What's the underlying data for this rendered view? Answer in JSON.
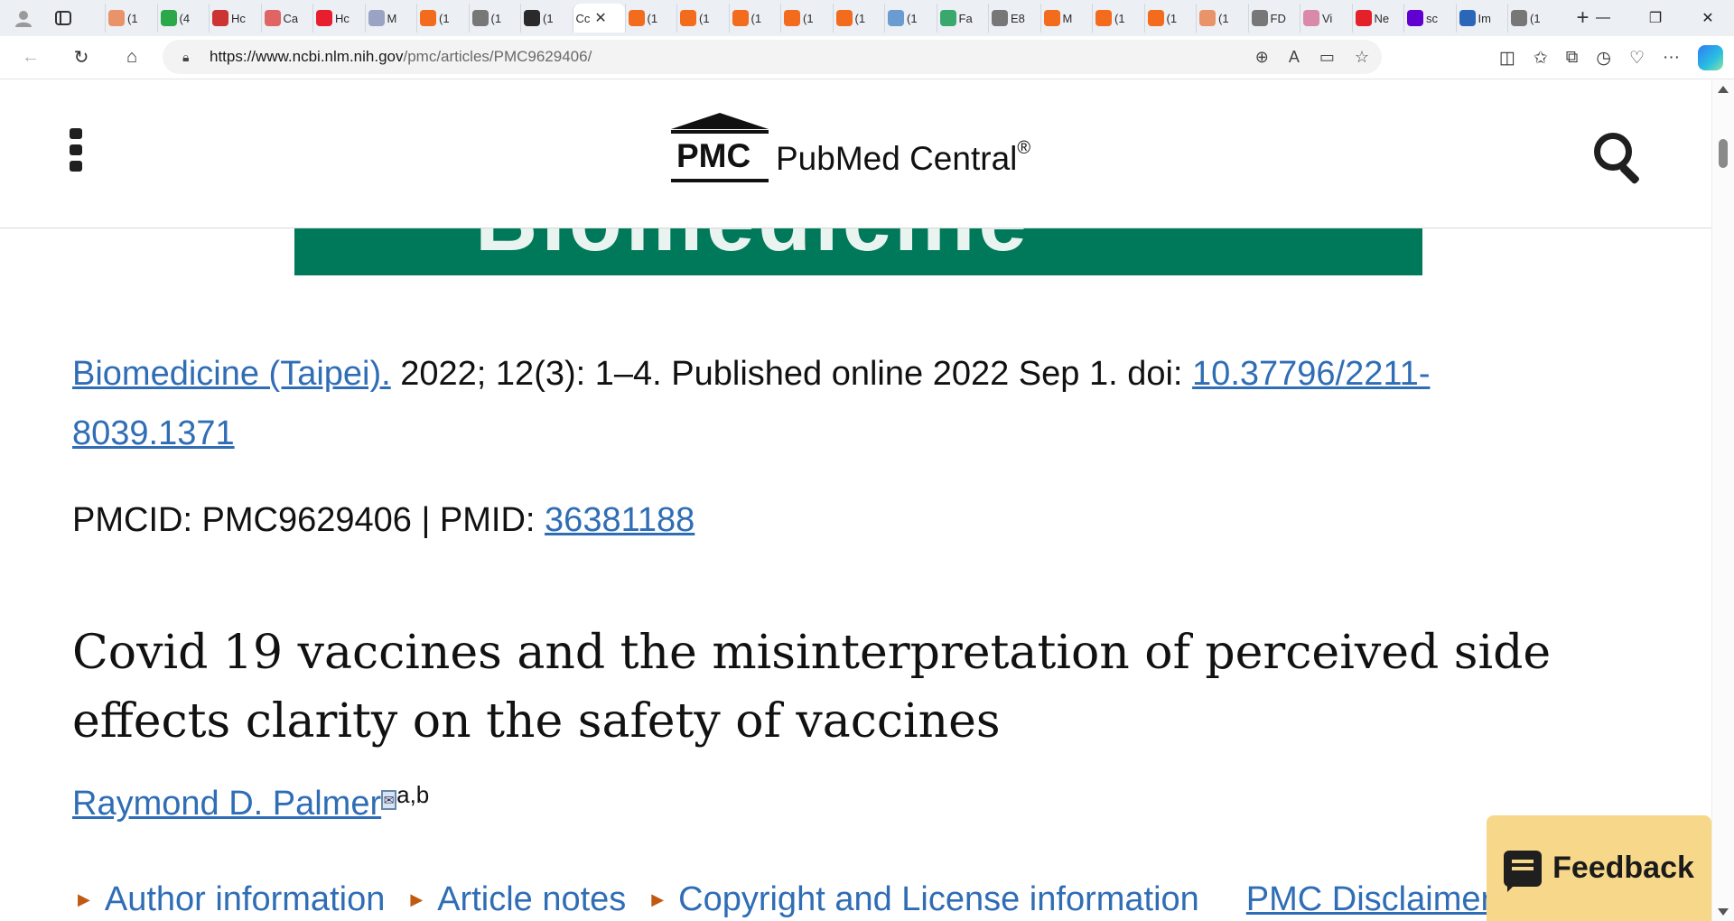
{
  "browser": {
    "tabs": [
      {
        "title": "(1",
        "icon": "bookmark-icon",
        "color": "#e8936a"
      },
      {
        "title": "(4",
        "icon": "g-icon",
        "color": "#2aa84a"
      },
      {
        "title": "Hc",
        "icon": "bi-icon",
        "color": "#cc3333"
      },
      {
        "title": "Ca",
        "icon": "video-icon",
        "color": "#e06464"
      },
      {
        "title": "Hc",
        "icon": "drop-icon",
        "color": "#e81d2d"
      },
      {
        "title": "M",
        "icon": "ai-icon",
        "color": "#9aa3c4"
      },
      {
        "title": "(1",
        "icon": "bookmark-icon",
        "color": "#f36b1c"
      },
      {
        "title": "(1",
        "icon": "page-icon",
        "color": "#777777"
      },
      {
        "title": "(1",
        "icon": "nfu-icon",
        "color": "#2a2a2a"
      },
      {
        "title": "Cc",
        "icon": "",
        "color": "#ffffff",
        "active": true
      },
      {
        "title": "(1",
        "icon": "bookmark-icon",
        "color": "#f36b1c"
      },
      {
        "title": "(1",
        "icon": "bookmark-icon",
        "color": "#f36b1c"
      },
      {
        "title": "(1",
        "icon": "bookmark-icon",
        "color": "#f36b1c"
      },
      {
        "title": "(1",
        "icon": "bookmark-icon",
        "color": "#f36b1c"
      },
      {
        "title": "(1",
        "icon": "bookmark-icon",
        "color": "#f36b1c"
      },
      {
        "title": "(1",
        "icon": "who-icon",
        "color": "#6a9bd1"
      },
      {
        "title": "Fa",
        "icon": "refresh-icon",
        "color": "#3aa76d"
      },
      {
        "title": "E8",
        "icon": "page-icon",
        "color": "#777777"
      },
      {
        "title": "M",
        "icon": "bookmark-icon",
        "color": "#f36b1c"
      },
      {
        "title": "(1",
        "icon": "bookmark-icon",
        "color": "#f36b1c"
      },
      {
        "title": "(1",
        "icon": "bookmark-icon",
        "color": "#f36b1c"
      },
      {
        "title": "(1",
        "icon": "bookmark-icon",
        "color": "#e8936a"
      },
      {
        "title": "FD",
        "icon": "page-icon",
        "color": "#777777"
      },
      {
        "title": "Vi",
        "icon": "star-icon",
        "color": "#d88aa8"
      },
      {
        "title": "Ne",
        "icon": "r-icon",
        "color": "#e4202a"
      },
      {
        "title": "sc",
        "icon": "y-icon",
        "color": "#6001d2"
      },
      {
        "title": "Im",
        "icon": "shield-icon",
        "color": "#2b66b8"
      },
      {
        "title": "(1",
        "icon": "page-icon",
        "color": "#777777"
      }
    ],
    "url_host": "https://www.ncbi.nlm.nih.gov",
    "url_path": "/pmc/articles/PMC9629406/"
  },
  "header": {
    "logo_mark": "PMC",
    "logo_text": "PubMed Central",
    "logo_reg": "®"
  },
  "banner": {
    "text": "Biomedicine",
    "color": "#00795a"
  },
  "citation": {
    "journal": "Biomedicine (Taipei).",
    "details": " 2022; 12(3): 1–4.  Published online 2022 Sep 1. doi: ",
    "doi": "10.37796/2211-8039.1371"
  },
  "ids": {
    "pmcid_label": "PMCID: PMC9629406 | PMID: ",
    "pmid": "36381188"
  },
  "article": {
    "title": "Covid 19 vaccines and the misinterpretation of perceived side effects clarity on the safety of vaccines",
    "author": "Raymond D. Palmer",
    "affiliations": "a,b"
  },
  "accordions": {
    "author_info": "Author information",
    "article_notes": "Article notes",
    "copyright": "Copyright and License information",
    "disclaimer": "PMC Disclaimer"
  },
  "feedback": {
    "label": "Feedback"
  }
}
